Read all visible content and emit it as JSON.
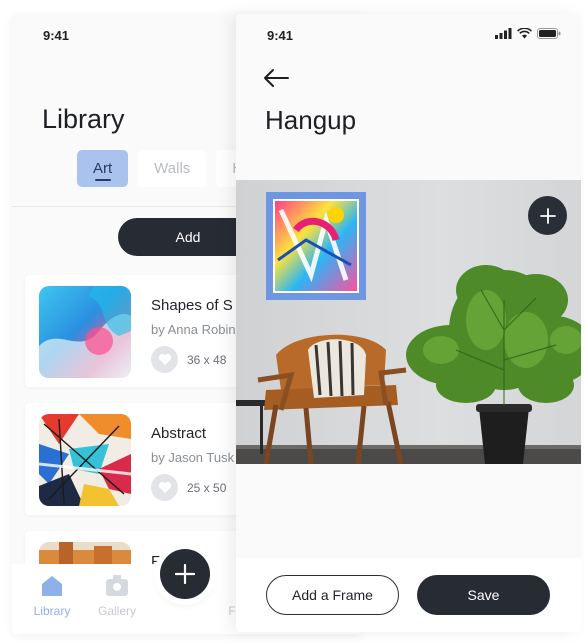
{
  "library_screen": {
    "time": "9:41",
    "title": "Library",
    "tabs": [
      {
        "label": "Art",
        "active": true
      },
      {
        "label": "Walls",
        "active": false
      },
      {
        "label": "H",
        "active": false
      }
    ],
    "add_button": "Add",
    "cards": [
      {
        "title": "Shapes of S",
        "author": "by Anna Robin",
        "size": "36 x 48",
        "thumb_icon": "abstract-fluid-art"
      },
      {
        "title": "Abstract",
        "author": "by Jason Tusk",
        "size": "25 x 50",
        "thumb_icon": "abstract-splatter-art"
      },
      {
        "title": "F",
        "author": "",
        "size": "",
        "thumb_icon": "orange-art"
      }
    ],
    "tabbar": {
      "items": [
        {
          "label": "Library",
          "icon": "home-icon",
          "active": true
        },
        {
          "label": "Gallery",
          "icon": "gallery-icon",
          "active": false
        },
        {
          "label": "F",
          "icon": "",
          "active": false
        }
      ],
      "fab_icon": "plus-icon"
    },
    "colors": {
      "accent": "#aac3ee",
      "dark": "#272b34"
    }
  },
  "hangup_screen": {
    "time": "9:41",
    "status_icons": [
      "signal-icon",
      "wifi-icon",
      "battery-icon"
    ],
    "back_icon": "arrow-left-icon",
    "title": "Hangup",
    "add_icon": "plus-icon",
    "buttons": {
      "add_frame": "Add a Frame",
      "save": "Save"
    }
  }
}
